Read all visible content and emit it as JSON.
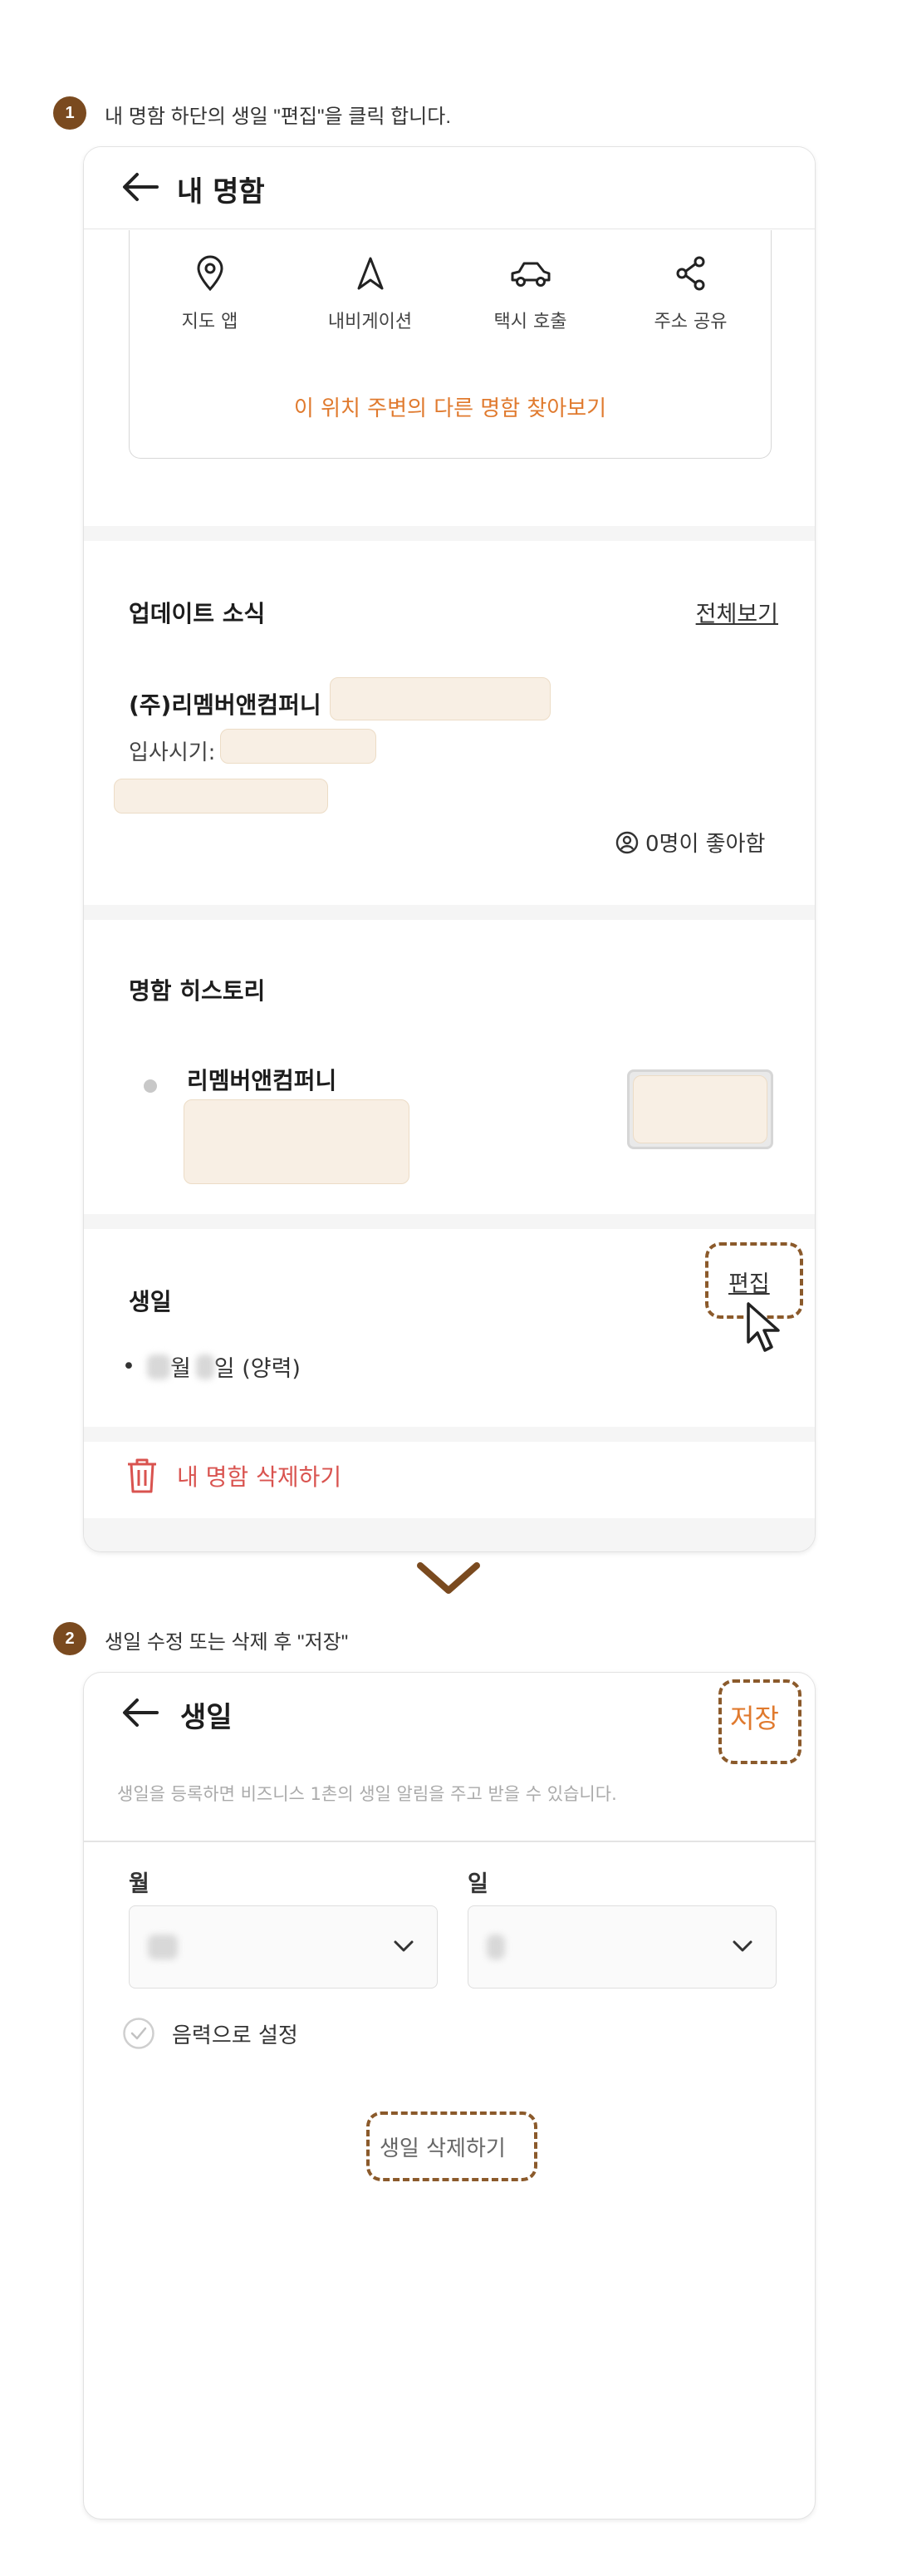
{
  "steps": [
    {
      "number": "1",
      "text": "내 명함 하단의 생일 \"편집\"을 클릭 합니다."
    },
    {
      "number": "2",
      "text": "생일 수정 또는 삭제 후 \"저장\""
    }
  ],
  "screen1": {
    "title": "내 명함",
    "map_actions": [
      {
        "label": "지도 앱",
        "icon": "location-pin-icon"
      },
      {
        "label": "내비게이션",
        "icon": "navigation-arrow-icon"
      },
      {
        "label": "택시 호출",
        "icon": "taxi-car-icon"
      },
      {
        "label": "주소 공유",
        "icon": "share-icon"
      }
    ],
    "nearby_link": "이 위치 주변의 다른 명함 찾아보기",
    "updates": {
      "title": "업데이트 소식",
      "view_all": "전체보기",
      "company": "(주)리멤버앤컴퍼니",
      "join_label": "입사시기:",
      "likes": "0명이 좋아함"
    },
    "history": {
      "title": "명함 히스토리",
      "company": "리멤버앤컴퍼니"
    },
    "birthday": {
      "title": "생일",
      "edit": "편집",
      "month_suffix": "월",
      "day_suffix": "일 (양력)"
    },
    "delete_card": "내 명함 삭제하기"
  },
  "screen2": {
    "title": "생일",
    "save": "저장",
    "notice": "생일을 등록하면 비즈니스 1촌의 생일 알림을 주고 받을 수 있습니다.",
    "month_label": "월",
    "day_label": "일",
    "lunar_label": "음력으로 설정",
    "delete_birthday": "생일 삭제하기"
  },
  "colors": {
    "accent_orange": "#e07a2e",
    "delete_red": "#d9534f",
    "step_badge": "#7a4a1f",
    "highlight_dash": "#8b5a2b"
  }
}
